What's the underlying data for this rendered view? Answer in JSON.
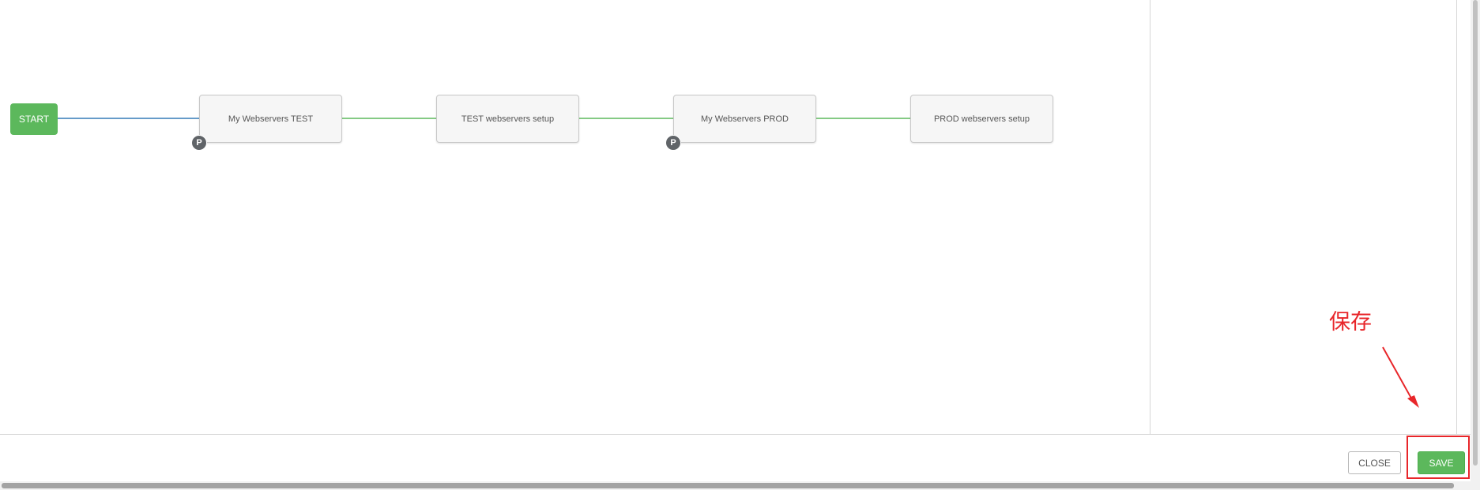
{
  "workflow": {
    "start_label": "START",
    "nodes": [
      {
        "label": "My Webservers TEST",
        "badge": "P"
      },
      {
        "label": "TEST webservers setup",
        "badge": ""
      },
      {
        "label": "My Webservers PROD",
        "badge": "P"
      },
      {
        "label": "PROD webservers setup",
        "badge": ""
      }
    ],
    "link_colors": {
      "always": "#337ab7",
      "success": "#5cb85c"
    }
  },
  "footer": {
    "close_label": "CLOSE",
    "save_label": "SAVE"
  },
  "annotation": {
    "text": "保存",
    "color": "#e8262a"
  }
}
